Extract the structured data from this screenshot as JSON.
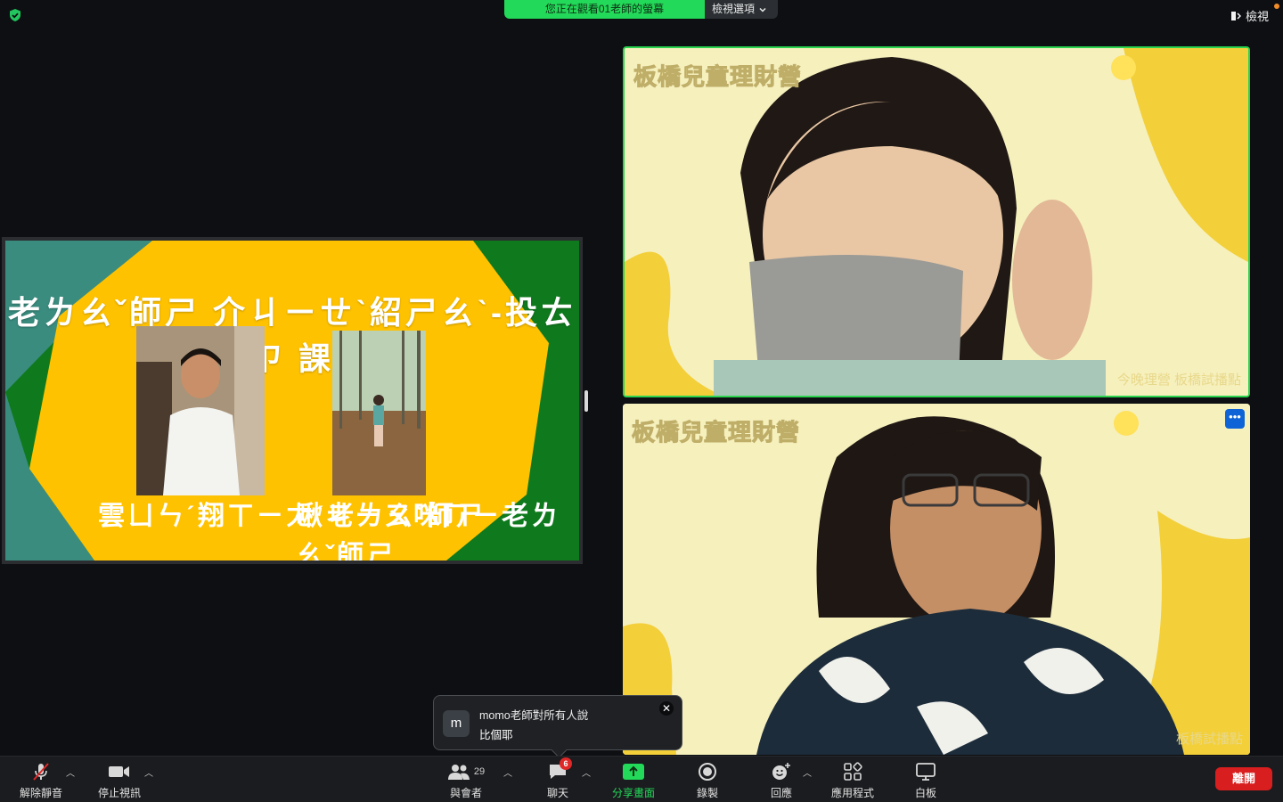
{
  "top_bar": {
    "share_banner": "您正在觀看01老師的螢幕",
    "view_options": "檢視選項",
    "view_button": "檢視"
  },
  "shared_screen": {
    "slide_title": "老ㄌㄠˇ師ㄕ 介ㄐㄧㄝˋ紹ㄕㄠˋ-投ㄊㄡˊ資ㄗ 課ㄎㄜˋ",
    "teacher_1": "雲ㄩㄣˊ翔ㄒㄧㄤˊ老ㄌㄠˇ師ㄕ",
    "teacher_2": "啾ㄐㄧㄡ咪ㄇㄧ老ㄌㄠˇ師ㄕ"
  },
  "video_tiles": [
    {
      "label": "板橋兒童理財營",
      "caption": "今晚理營 板橋試播點"
    },
    {
      "label": "板橋兒童理財營",
      "caption": "板橋試播點",
      "more_icon": "more-icon"
    }
  ],
  "chat_toast": {
    "avatar": "m",
    "sender": "momo老師對所有人說",
    "message": "比個耶"
  },
  "toolbar": {
    "unmute": "解除靜音",
    "stop_video": "停止視訊",
    "participants": "與會者",
    "participants_count": "29",
    "chat": "聊天",
    "chat_badge": "6",
    "share_screen": "分享畫面",
    "record": "錄製",
    "reactions": "回應",
    "apps": "應用程式",
    "whiteboard": "白板",
    "leave": "離開"
  },
  "colors": {
    "share_green": "#23d959",
    "leave_red": "#d81e1e",
    "active_speaker_border": "#2bd34f",
    "slide_yellow": "#ffc200",
    "slide_teal": "#3a8c7f",
    "slide_green": "#0f7a1d"
  }
}
